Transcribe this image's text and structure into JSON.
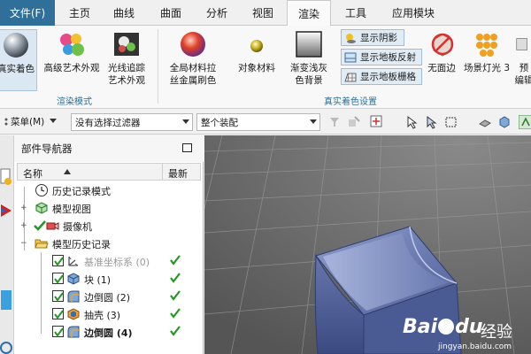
{
  "menu": {
    "file": "文件(F)",
    "tabs": [
      {
        "label": "主页"
      },
      {
        "label": "曲线"
      },
      {
        "label": "曲面"
      },
      {
        "label": "分析"
      },
      {
        "label": "视图"
      },
      {
        "label": "渲染"
      },
      {
        "label": "工具"
      },
      {
        "label": "应用模块"
      }
    ]
  },
  "ribbon": {
    "buttons": [
      {
        "label": "真实着色"
      },
      {
        "label": "高级艺术外观"
      },
      {
        "label1": "光线追踪",
        "label2": "艺术外观"
      },
      {
        "label1": "全局材料拉",
        "label2": "丝金属刷色"
      },
      {
        "label": "对象材料"
      },
      {
        "label1": "渐变浅灰",
        "label2": "色背景"
      },
      {
        "label": "无面边"
      },
      {
        "label": "场景灯光 3"
      },
      {
        "label1": "预",
        "label2": "编辑"
      }
    ],
    "small_buttons": [
      {
        "label": "显示阴影"
      },
      {
        "label": "显示地板反射"
      },
      {
        "label": "显示地板栅格"
      }
    ],
    "group_labels": [
      "渲染模式",
      "真实着色设置"
    ]
  },
  "toolbar": {
    "menu_label": "菜单(M)",
    "filter": "没有选择过滤器",
    "assembly": "整个装配"
  },
  "navigator": {
    "title": "部件导航器",
    "col_name": "名称",
    "col_latest": "最新",
    "rows": [
      {
        "label": "历史记录模式"
      },
      {
        "label": "模型视图"
      },
      {
        "label": "摄像机"
      },
      {
        "label": "模型历史记录"
      },
      {
        "label": "基准坐标系 (0)"
      },
      {
        "label": "块 (1)"
      },
      {
        "label": "边倒圆 (2)"
      },
      {
        "label": "抽壳 (3)"
      },
      {
        "label": "边倒圆 (4)"
      }
    ],
    "latest_mark": "✔"
  },
  "watermark": {
    "brand": "Bai",
    "brand2": "du",
    "suffix": "经验",
    "url": "jingyan.baidu.com"
  },
  "colors": {
    "accent": "#2f6f9a",
    "check_green": "#1f9a1f",
    "part": "#5f6fa6"
  }
}
